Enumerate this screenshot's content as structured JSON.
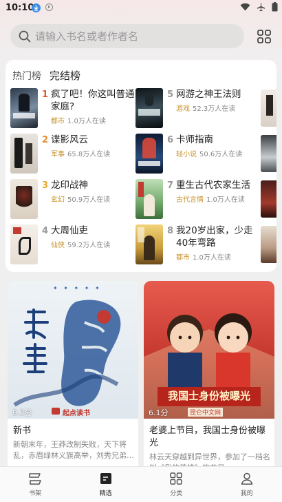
{
  "status": {
    "time": "10:10"
  },
  "search": {
    "placeholder": "请输入书名或者作者名"
  },
  "ranking": {
    "tabs": [
      "热门榜",
      "完结榜"
    ],
    "items": [
      {
        "rank": "1",
        "title": "疯了吧！你这叫普通家庭?",
        "category": "都市",
        "readers": "1.0万人在读",
        "rank_color": "#e05a2b"
      },
      {
        "rank": "2",
        "title": "谍影风云",
        "category": "军事",
        "readers": "65.8万人在读",
        "rank_color": "#e88a2b"
      },
      {
        "rank": "3",
        "title": "龙印战神",
        "category": "玄幻",
        "readers": "50.9万人在读",
        "rank_color": "#e8a72b"
      },
      {
        "rank": "4",
        "title": "大周仙吏",
        "category": "仙侠",
        "readers": "59.2万人在读",
        "rank_color": "#999999"
      },
      {
        "rank": "5",
        "title": "网游之神王法则",
        "category": "游戏",
        "readers": "52.3万人在读",
        "rank_color": "#999999"
      },
      {
        "rank": "6",
        "title": "卡师指南",
        "category": "轻小说",
        "readers": "50.6万人在读",
        "rank_color": "#999999"
      },
      {
        "rank": "7",
        "title": "重生古代农家生活",
        "category": "古代言情",
        "readers": "1.0万人在读",
        "rank_color": "#999999"
      },
      {
        "rank": "8",
        "title": "我20岁出家，少走40年弯路",
        "category": "都市",
        "readers": "1.0万人在读",
        "rank_color": "#999999"
      }
    ]
  },
  "promos": [
    {
      "title": "新书",
      "score": "9.3分",
      "logo_text": "起点读书",
      "desc": "新朝末年，王莽改制失败，天下将乱，赤眉绿林义旗高举，刘秀兄弟…"
    },
    {
      "title": "老婆上节目，我国士身份被曝光",
      "score": "6.1分",
      "logo_text": "昆仑中文网",
      "cover_text": "我国士身份被曝光",
      "desc": "林云天穿越到异世界，参加了一档名叫《我的英雄》的节目…"
    }
  ],
  "nav": [
    {
      "label": "书架",
      "icon": "bookshelf-icon"
    },
    {
      "label": "精选",
      "icon": "featured-icon"
    },
    {
      "label": "分类",
      "icon": "category-icon"
    },
    {
      "label": "我的",
      "icon": "profile-icon"
    }
  ],
  "colors": {
    "category": "#c9922a",
    "accent_red": "#c23a32"
  }
}
